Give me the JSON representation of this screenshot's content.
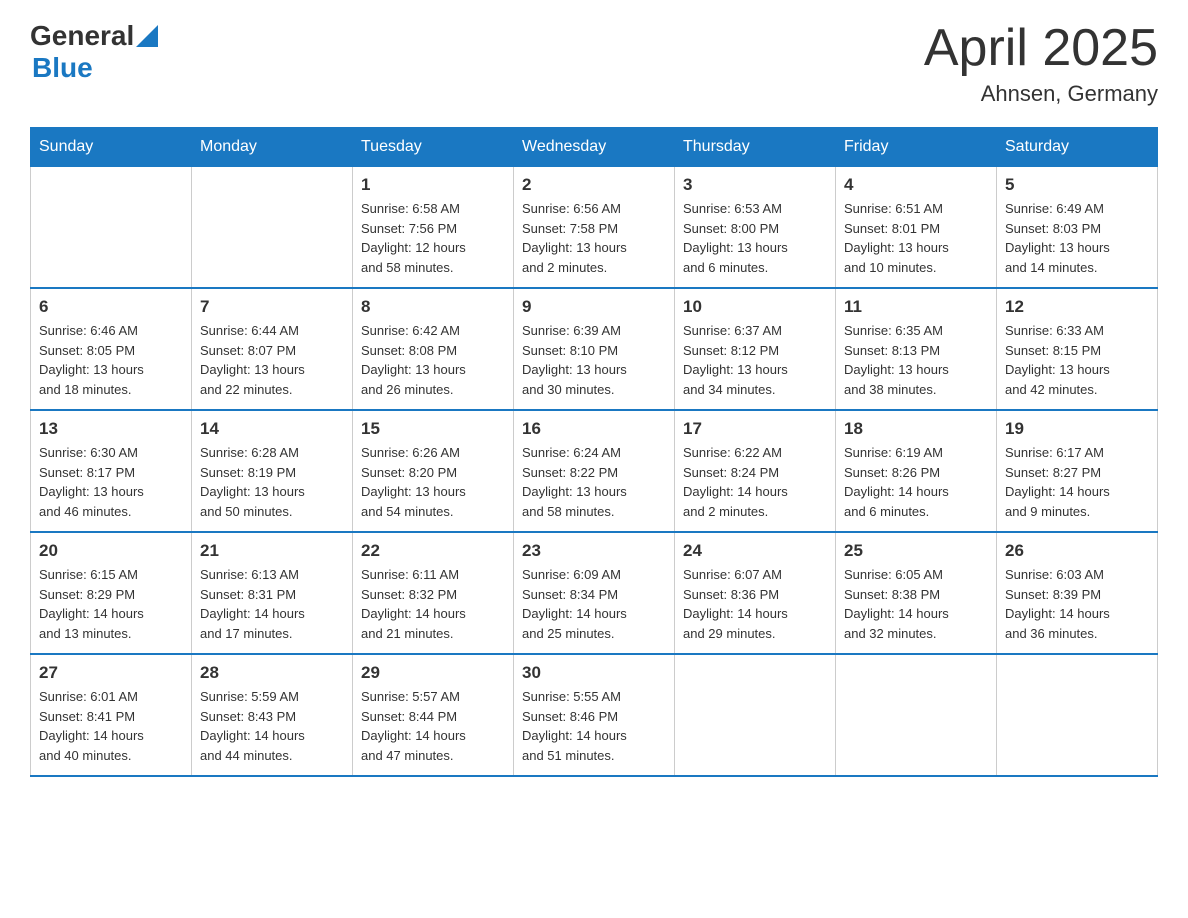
{
  "header": {
    "logo_general": "General",
    "logo_blue": "Blue",
    "title": "April 2025",
    "subtitle": "Ahnsen, Germany"
  },
  "days_of_week": [
    "Sunday",
    "Monday",
    "Tuesday",
    "Wednesday",
    "Thursday",
    "Friday",
    "Saturday"
  ],
  "weeks": [
    [
      {
        "day": "",
        "info": ""
      },
      {
        "day": "",
        "info": ""
      },
      {
        "day": "1",
        "info": "Sunrise: 6:58 AM\nSunset: 7:56 PM\nDaylight: 12 hours\nand 58 minutes."
      },
      {
        "day": "2",
        "info": "Sunrise: 6:56 AM\nSunset: 7:58 PM\nDaylight: 13 hours\nand 2 minutes."
      },
      {
        "day": "3",
        "info": "Sunrise: 6:53 AM\nSunset: 8:00 PM\nDaylight: 13 hours\nand 6 minutes."
      },
      {
        "day": "4",
        "info": "Sunrise: 6:51 AM\nSunset: 8:01 PM\nDaylight: 13 hours\nand 10 minutes."
      },
      {
        "day": "5",
        "info": "Sunrise: 6:49 AM\nSunset: 8:03 PM\nDaylight: 13 hours\nand 14 minutes."
      }
    ],
    [
      {
        "day": "6",
        "info": "Sunrise: 6:46 AM\nSunset: 8:05 PM\nDaylight: 13 hours\nand 18 minutes."
      },
      {
        "day": "7",
        "info": "Sunrise: 6:44 AM\nSunset: 8:07 PM\nDaylight: 13 hours\nand 22 minutes."
      },
      {
        "day": "8",
        "info": "Sunrise: 6:42 AM\nSunset: 8:08 PM\nDaylight: 13 hours\nand 26 minutes."
      },
      {
        "day": "9",
        "info": "Sunrise: 6:39 AM\nSunset: 8:10 PM\nDaylight: 13 hours\nand 30 minutes."
      },
      {
        "day": "10",
        "info": "Sunrise: 6:37 AM\nSunset: 8:12 PM\nDaylight: 13 hours\nand 34 minutes."
      },
      {
        "day": "11",
        "info": "Sunrise: 6:35 AM\nSunset: 8:13 PM\nDaylight: 13 hours\nand 38 minutes."
      },
      {
        "day": "12",
        "info": "Sunrise: 6:33 AM\nSunset: 8:15 PM\nDaylight: 13 hours\nand 42 minutes."
      }
    ],
    [
      {
        "day": "13",
        "info": "Sunrise: 6:30 AM\nSunset: 8:17 PM\nDaylight: 13 hours\nand 46 minutes."
      },
      {
        "day": "14",
        "info": "Sunrise: 6:28 AM\nSunset: 8:19 PM\nDaylight: 13 hours\nand 50 minutes."
      },
      {
        "day": "15",
        "info": "Sunrise: 6:26 AM\nSunset: 8:20 PM\nDaylight: 13 hours\nand 54 minutes."
      },
      {
        "day": "16",
        "info": "Sunrise: 6:24 AM\nSunset: 8:22 PM\nDaylight: 13 hours\nand 58 minutes."
      },
      {
        "day": "17",
        "info": "Sunrise: 6:22 AM\nSunset: 8:24 PM\nDaylight: 14 hours\nand 2 minutes."
      },
      {
        "day": "18",
        "info": "Sunrise: 6:19 AM\nSunset: 8:26 PM\nDaylight: 14 hours\nand 6 minutes."
      },
      {
        "day": "19",
        "info": "Sunrise: 6:17 AM\nSunset: 8:27 PM\nDaylight: 14 hours\nand 9 minutes."
      }
    ],
    [
      {
        "day": "20",
        "info": "Sunrise: 6:15 AM\nSunset: 8:29 PM\nDaylight: 14 hours\nand 13 minutes."
      },
      {
        "day": "21",
        "info": "Sunrise: 6:13 AM\nSunset: 8:31 PM\nDaylight: 14 hours\nand 17 minutes."
      },
      {
        "day": "22",
        "info": "Sunrise: 6:11 AM\nSunset: 8:32 PM\nDaylight: 14 hours\nand 21 minutes."
      },
      {
        "day": "23",
        "info": "Sunrise: 6:09 AM\nSunset: 8:34 PM\nDaylight: 14 hours\nand 25 minutes."
      },
      {
        "day": "24",
        "info": "Sunrise: 6:07 AM\nSunset: 8:36 PM\nDaylight: 14 hours\nand 29 minutes."
      },
      {
        "day": "25",
        "info": "Sunrise: 6:05 AM\nSunset: 8:38 PM\nDaylight: 14 hours\nand 32 minutes."
      },
      {
        "day": "26",
        "info": "Sunrise: 6:03 AM\nSunset: 8:39 PM\nDaylight: 14 hours\nand 36 minutes."
      }
    ],
    [
      {
        "day": "27",
        "info": "Sunrise: 6:01 AM\nSunset: 8:41 PM\nDaylight: 14 hours\nand 40 minutes."
      },
      {
        "day": "28",
        "info": "Sunrise: 5:59 AM\nSunset: 8:43 PM\nDaylight: 14 hours\nand 44 minutes."
      },
      {
        "day": "29",
        "info": "Sunrise: 5:57 AM\nSunset: 8:44 PM\nDaylight: 14 hours\nand 47 minutes."
      },
      {
        "day": "30",
        "info": "Sunrise: 5:55 AM\nSunset: 8:46 PM\nDaylight: 14 hours\nand 51 minutes."
      },
      {
        "day": "",
        "info": ""
      },
      {
        "day": "",
        "info": ""
      },
      {
        "day": "",
        "info": ""
      }
    ]
  ]
}
